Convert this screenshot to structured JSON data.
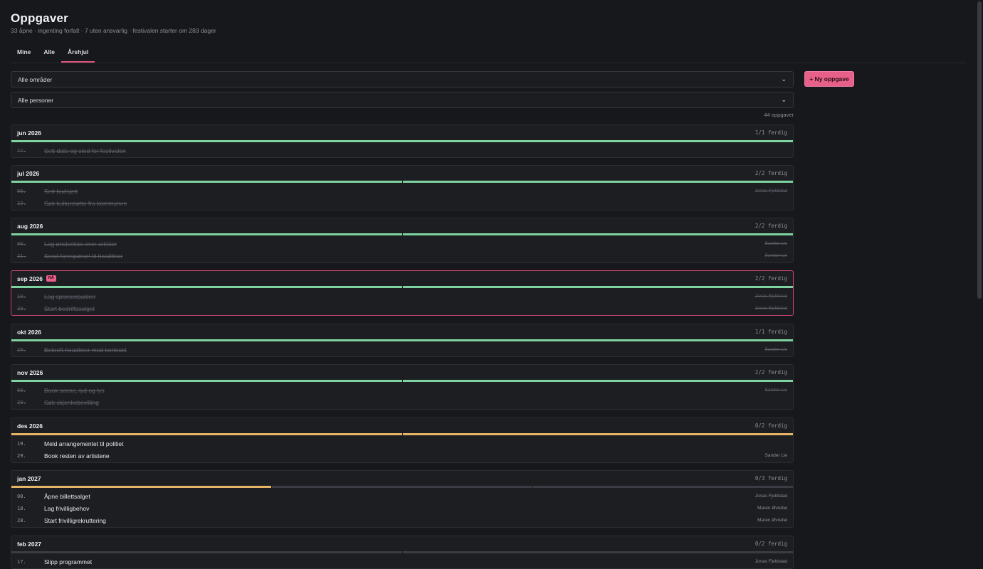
{
  "header": {
    "title": "Oppgaver",
    "subtitle": "33 åpne · ingenting forfalt · 7 uten ansvarlig · festivalen starter om 283 dager"
  },
  "tabs": [
    {
      "label": "Mine"
    },
    {
      "label": "Alle"
    },
    {
      "label": "Årshjul"
    }
  ],
  "filters": {
    "area": "Alle områder",
    "person": "Alle personer"
  },
  "new_task_label": "+ Ny oppgave",
  "task_count": "44 oppgaver",
  "current_badge": "NÅ",
  "months": [
    {
      "label": "jun 2026",
      "progress": "1/1 ferdig",
      "current": false,
      "bar": [
        "done"
      ],
      "tasks": [
        {
          "day": "??.",
          "title": "Sett dato og sted for festivalen",
          "owner": "",
          "done": true
        }
      ]
    },
    {
      "label": "jul 2026",
      "progress": "2/2 ferdig",
      "current": false,
      "bar": [
        "done",
        "done"
      ],
      "tasks": [
        {
          "day": "08.",
          "title": "Sett budsjett",
          "owner": "Jonas Fjeldstad",
          "done": true
        },
        {
          "day": "22.",
          "title": "Søk kulturstøtte fra kommunen",
          "owner": "",
          "done": true
        }
      ]
    },
    {
      "label": "aug 2026",
      "progress": "2/2 ferdig",
      "current": false,
      "bar": [
        "done",
        "done"
      ],
      "tasks": [
        {
          "day": "08.",
          "title": "Lag ønskeliste over artister",
          "owner": "Sander Lie",
          "done": true
        },
        {
          "day": "21.",
          "title": "Send forespørsel til headliner",
          "owner": "Sander Lie",
          "done": true
        }
      ]
    },
    {
      "label": "sep 2026",
      "progress": "2/2 ferdig",
      "current": true,
      "bar": [
        "done",
        "done"
      ],
      "tasks": [
        {
          "day": "10.",
          "title": "Lag sponsorpakker",
          "owner": "Jonas Fjeldstad",
          "done": true
        },
        {
          "day": "30.",
          "title": "Start bedriftssalget",
          "owner": "Jonas Fjeldstad",
          "done": true
        }
      ]
    },
    {
      "label": "okt 2026",
      "progress": "1/1 ferdig",
      "current": false,
      "bar": [
        "done"
      ],
      "tasks": [
        {
          "day": "20.",
          "title": "Bekreft headliner med kontrakt",
          "owner": "Sander Lie",
          "done": true
        }
      ]
    },
    {
      "label": "nov 2026",
      "progress": "2/2 ferdig",
      "current": false,
      "bar": [
        "done",
        "done"
      ],
      "tasks": [
        {
          "day": "08.",
          "title": "Book scene, lyd og lys",
          "owner": "Sander Lie",
          "done": true
        },
        {
          "day": "29.",
          "title": "Søk skjenkebevilling",
          "owner": "",
          "done": true
        }
      ]
    },
    {
      "label": "des 2026",
      "progress": "0/2 ferdig",
      "current": false,
      "bar": [
        "due",
        "due"
      ],
      "tasks": [
        {
          "day": "19.",
          "title": "Meld arrangementet til politiet",
          "owner": "",
          "done": false
        },
        {
          "day": "29.",
          "title": "Book resten av artistene",
          "owner": "Sander Lie",
          "done": false
        }
      ]
    },
    {
      "label": "jan 2027",
      "progress": "0/3 ferdig",
      "current": false,
      "bar": [
        "due",
        "open",
        "open"
      ],
      "tasks": [
        {
          "day": "08.",
          "title": "Åpne billettsalget",
          "owner": "Jonas Fjeldstad",
          "done": false
        },
        {
          "day": "18.",
          "title": "Lag frivilligbehov",
          "owner": "Maren Øvrebø",
          "done": false
        },
        {
          "day": "28.",
          "title": "Start frivilligrekruttering",
          "owner": "Maren Øvrebø",
          "done": false
        }
      ]
    },
    {
      "label": "feb 2027",
      "progress": "0/2 ferdig",
      "current": false,
      "bar": [
        "open",
        "open"
      ],
      "tasks": [
        {
          "day": "17.",
          "title": "Slipp programmet",
          "owner": "Jonas Fjeldstad",
          "done": false
        }
      ]
    }
  ]
}
